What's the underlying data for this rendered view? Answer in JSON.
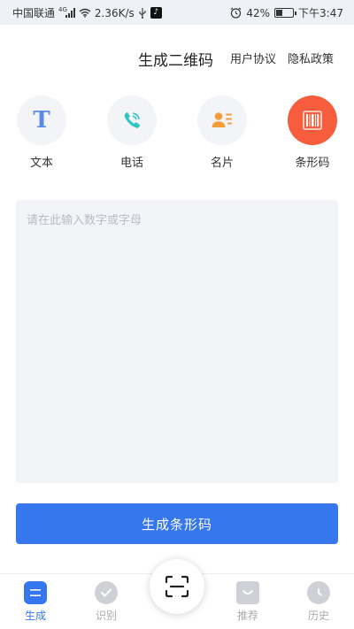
{
  "status_bar": {
    "carrier": "中国联通",
    "network": "4G",
    "speed": "2.36K/s",
    "battery": "42%",
    "battery_level": 0.42,
    "time": "下午3:47",
    "icons": [
      "signal-icon",
      "wifi-icon",
      "usb-icon",
      "tiktok-icon",
      "alarm-icon",
      "battery-icon"
    ]
  },
  "header": {
    "title": "生成二维码",
    "terms_link": "用户协议",
    "privacy_link": "隐私政策"
  },
  "types": [
    {
      "label": "文本",
      "icon": "text-icon",
      "glyph": "T",
      "selected": false
    },
    {
      "label": "电话",
      "icon": "phone-icon",
      "selected": false
    },
    {
      "label": "名片",
      "icon": "contact-card-icon",
      "selected": false
    },
    {
      "label": "条形码",
      "icon": "barcode-icon",
      "selected": true
    }
  ],
  "input": {
    "placeholder": "请在此输入数字或字母",
    "value": ""
  },
  "generate_button": "生成条形码",
  "tabs": [
    {
      "label": "生成",
      "icon": "generate-icon",
      "active": true
    },
    {
      "label": "识别",
      "icon": "recognize-icon",
      "active": false
    },
    {
      "label": "推荐",
      "icon": "recommend-icon",
      "active": false
    },
    {
      "label": "历史",
      "icon": "history-icon",
      "active": false
    }
  ],
  "scan_button": {
    "icon": "scan-icon"
  },
  "colors": {
    "accent": "#3777ee",
    "selected_type": "#f65d3c",
    "phone_icon": "#2ec4c1",
    "contact_icon": "#f39c3a",
    "text_icon": "#5a8be6"
  }
}
